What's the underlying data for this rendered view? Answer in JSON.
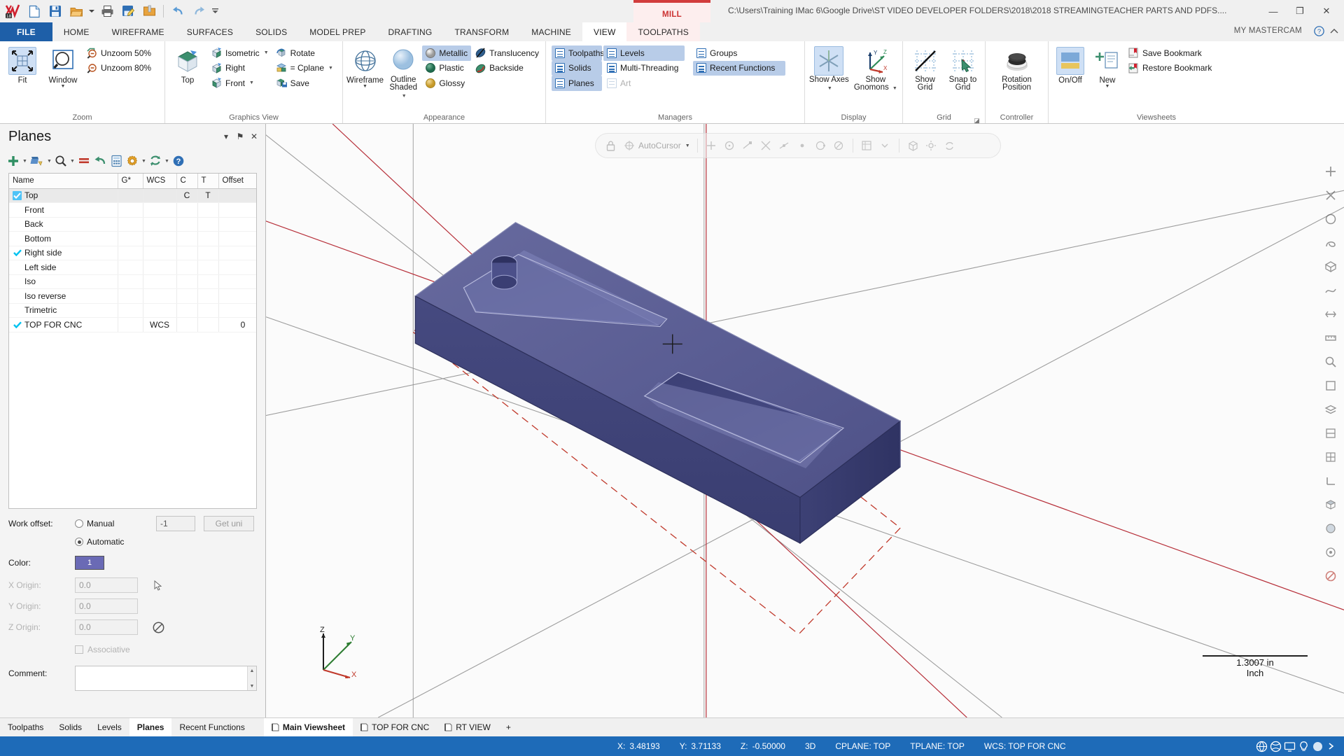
{
  "titlebar": {
    "quick_access": [
      {
        "name": "mastercam-logo",
        "label": "Mastercam 2018"
      },
      {
        "name": "new-icon",
        "label": "New"
      },
      {
        "name": "save-icon",
        "label": "Save"
      },
      {
        "name": "open-icon",
        "label": "Open"
      },
      {
        "name": "print-icon",
        "label": "Print"
      },
      {
        "name": "save-as-icon",
        "label": "Save As"
      },
      {
        "name": "zip2go-icon",
        "label": "Zip2Go"
      },
      {
        "name": "undo-icon",
        "label": "Undo"
      },
      {
        "name": "redo-icon",
        "label": "Redo"
      },
      {
        "name": "customize-qat-icon",
        "label": "Customize Quick Access Toolbar"
      }
    ],
    "machine_tag": "MILL",
    "document_path": "C:\\Users\\Training IMac 6\\Google Drive\\ST VIDEO DEVELOPER FOLDERS\\2018\\2018 STREAMINGTEACHER PARTS AND PDFS....",
    "window_buttons": {
      "minimize": "—",
      "restore": "❐",
      "close": "✕"
    }
  },
  "ribbon": {
    "tabs": [
      {
        "label": "FILE",
        "state": "file"
      },
      {
        "label": "HOME",
        "state": "normal"
      },
      {
        "label": "WIREFRAME",
        "state": "normal"
      },
      {
        "label": "SURFACES",
        "state": "normal"
      },
      {
        "label": "SOLIDS",
        "state": "normal"
      },
      {
        "label": "MODEL PREP",
        "state": "normal"
      },
      {
        "label": "DRAFTING",
        "state": "normal"
      },
      {
        "label": "TRANSFORM",
        "state": "normal"
      },
      {
        "label": "MACHINE",
        "state": "normal"
      },
      {
        "label": "VIEW",
        "state": "active"
      },
      {
        "label": "TOOLPATHS",
        "state": "toolpaths"
      }
    ],
    "brand_label": "MY MASTERCAM",
    "help_icons": [
      {
        "name": "help-icon",
        "label": "?"
      },
      {
        "name": "collapse-ribbon-icon",
        "label": "˄"
      }
    ],
    "groups": [
      {
        "name": "zoom",
        "title": "Zoom",
        "big_buttons": [
          {
            "name": "fit-button",
            "label": "Fit",
            "selected": true
          },
          {
            "name": "window-zoom-button",
            "label": "Window",
            "has_caret": true
          }
        ],
        "small_buttons": [
          {
            "name": "unzoom-50-button",
            "label": "Unzoom 50%"
          },
          {
            "name": "unzoom-80-button",
            "label": "Unzoom 80%"
          }
        ]
      },
      {
        "name": "graphics-view",
        "title": "Graphics View",
        "big_buttons": [
          {
            "name": "top-view-button",
            "label": "Top"
          }
        ],
        "small_buttons": [
          {
            "name": "isometric-view-button",
            "label": "Isometric",
            "has_caret": true
          },
          {
            "name": "right-view-button",
            "label": "Right"
          },
          {
            "name": "front-view-button",
            "label": "Front",
            "has_caret": true
          },
          {
            "name": "rotate-button",
            "label": "Rotate"
          },
          {
            "name": "equal-cplane-button",
            "label": "= Cplane",
            "has_caret": true
          },
          {
            "name": "save-view-button",
            "label": "Save"
          }
        ]
      },
      {
        "name": "appearance",
        "title": "Appearance",
        "big_buttons": [
          {
            "name": "wireframe-button",
            "label": "Wireframe",
            "has_caret": true
          },
          {
            "name": "outline-shaded-button",
            "label": "Outline Shaded",
            "has_caret": true
          }
        ],
        "small_buttons": [
          {
            "name": "metallic-button",
            "label": "Metallic",
            "highlighted": true
          },
          {
            "name": "plastic-button",
            "label": "Plastic"
          },
          {
            "name": "glossy-button",
            "label": "Glossy"
          },
          {
            "name": "translucency-button",
            "label": "Translucency"
          },
          {
            "name": "backside-button",
            "label": "Backside"
          }
        ]
      },
      {
        "name": "managers",
        "title": "Managers",
        "small_buttons": [
          {
            "name": "toolpaths-manager-button",
            "label": "Toolpaths",
            "highlighted": true
          },
          {
            "name": "solids-manager-button",
            "label": "Solids",
            "highlighted": true
          },
          {
            "name": "planes-manager-button",
            "label": "Planes",
            "highlighted": true
          },
          {
            "name": "levels-manager-button",
            "label": "Levels",
            "highlighted": true
          },
          {
            "name": "multi-threading-manager-button",
            "label": "Multi-Threading"
          },
          {
            "name": "art-manager-button",
            "label": "Art",
            "disabled": true
          },
          {
            "name": "groups-manager-button",
            "label": "Groups"
          },
          {
            "name": "recent-functions-button",
            "label": "Recent Functions",
            "highlighted": true
          }
        ]
      },
      {
        "name": "display",
        "title": "Display",
        "big_buttons": [
          {
            "name": "show-axes-button",
            "label": "Show Axes",
            "has_caret": true,
            "selected": true
          },
          {
            "name": "show-gnomons-button",
            "label": "Show Gnomons",
            "has_caret": true
          }
        ]
      },
      {
        "name": "grid",
        "title": "Grid",
        "big_buttons": [
          {
            "name": "show-grid-button",
            "label": "Show Grid"
          },
          {
            "name": "snap-to-grid-button",
            "label": "Snap to Grid"
          }
        ]
      },
      {
        "name": "controller",
        "title": "Controller",
        "big_buttons": [
          {
            "name": "rotation-position-button",
            "label": "Rotation Position"
          }
        ]
      },
      {
        "name": "viewsheets",
        "title": "Viewsheets",
        "big_buttons": [
          {
            "name": "viewsheets-onoff-button",
            "label": "On/Off",
            "selected": true
          },
          {
            "name": "new-viewsheet-button",
            "label": "New",
            "has_caret": true
          }
        ],
        "small_buttons": [
          {
            "name": "save-bookmark-button",
            "label": "Save Bookmark"
          },
          {
            "name": "restore-bookmark-button",
            "label": "Restore Bookmark"
          }
        ]
      }
    ]
  },
  "planes_panel": {
    "title": "Planes",
    "header_buttons": [
      {
        "name": "panel-dropdown-icon",
        "label": "▾"
      },
      {
        "name": "panel-pin-icon",
        "label": "⚑"
      },
      {
        "name": "panel-close-icon",
        "label": "✕"
      }
    ],
    "toolbar": [
      {
        "name": "create-new-plane-button",
        "label": "Create new plane",
        "caret": true
      },
      {
        "name": "select-plane-button",
        "label": "Select plane",
        "caret": true
      },
      {
        "name": "find-plane-button",
        "label": "Find plane",
        "caret": true
      },
      {
        "name": "delete-plane-button",
        "label": "Delete plane"
      },
      {
        "name": "undo-plane-button",
        "label": "Undo"
      },
      {
        "name": "plane-list-button",
        "label": "Plane list"
      },
      {
        "name": "plane-settings-button",
        "label": "Settings",
        "caret": true
      },
      {
        "name": "refresh-planes-button",
        "label": "Refresh",
        "caret": true
      },
      {
        "name": "plane-help-button",
        "label": "Help"
      }
    ],
    "table": {
      "columns": [
        "Name",
        "G*",
        "WCS",
        "C",
        "T",
        "Offset"
      ],
      "rows": [
        {
          "name": "Top",
          "check": "box",
          "g": "",
          "wcs": "",
          "c": "C",
          "t": "T",
          "offset": "",
          "selected": true
        },
        {
          "name": "Front",
          "check": "none",
          "g": "",
          "wcs": "",
          "c": "",
          "t": "",
          "offset": ""
        },
        {
          "name": "Back",
          "check": "none",
          "g": "",
          "wcs": "",
          "c": "",
          "t": "",
          "offset": ""
        },
        {
          "name": "Bottom",
          "check": "none",
          "g": "",
          "wcs": "",
          "c": "",
          "t": "",
          "offset": ""
        },
        {
          "name": "Right side",
          "check": "tick",
          "g": "",
          "wcs": "",
          "c": "",
          "t": "",
          "offset": ""
        },
        {
          "name": "Left side",
          "check": "none",
          "g": "",
          "wcs": "",
          "c": "",
          "t": "",
          "offset": ""
        },
        {
          "name": "Iso",
          "check": "none",
          "g": "",
          "wcs": "",
          "c": "",
          "t": "",
          "offset": ""
        },
        {
          "name": "Iso reverse",
          "check": "none",
          "g": "",
          "wcs": "",
          "c": "",
          "t": "",
          "offset": ""
        },
        {
          "name": "Trimetric",
          "check": "none",
          "g": "",
          "wcs": "",
          "c": "",
          "t": "",
          "offset": ""
        },
        {
          "name": "TOP FOR CNC",
          "check": "tick",
          "g": "",
          "wcs": "WCS",
          "c": "",
          "t": "",
          "offset": "0"
        }
      ]
    },
    "form": {
      "work_offset_label": "Work offset:",
      "manual_label": "Manual",
      "automatic_label": "Automatic",
      "work_offset_mode": "Automatic",
      "work_offset_value": "-1",
      "get_unique_label": "Get uni",
      "color_label": "Color:",
      "color_value": "1",
      "color_hex": "#6a6ab5",
      "x_origin_label": "X Origin:",
      "x_origin_value": "0.0",
      "y_origin_label": "Y Origin:",
      "y_origin_value": "0.0",
      "z_origin_label": "Z Origin:",
      "z_origin_value": "0.0",
      "associative_label": "Associative",
      "comment_label": "Comment:",
      "comment_value": ""
    }
  },
  "viewport": {
    "autocursor": {
      "label": "AutoCursor",
      "icons": [
        "autocursor-origin-icon",
        "autocursor-arc-center-icon",
        "autocursor-endpoint-icon",
        "autocursor-intersection-icon",
        "autocursor-midpoint-icon",
        "autocursor-point-icon",
        "autocursor-quadrant-icon",
        "autocursor-nearest-icon",
        "autocursor-relative-icon",
        "autocursor-tangent-icon",
        "autocursor-perpendicular-icon",
        "autocursor-solid-icon",
        "autocursor-settings-icon",
        "autocursor-refresh-icon"
      ]
    },
    "scale": {
      "value": "1.3007 in",
      "unit": "Inch"
    },
    "gnomon": {
      "x": "X",
      "y": "Y",
      "z": "Z"
    },
    "right_toolbar": [
      "fit-icon",
      "dynamic-rotate-icon",
      "circle-icon",
      "spiral-icon",
      "mesh-icon",
      "surface-icon",
      "flip-icon",
      "ruler-icon",
      "analyze-icon",
      "box-icon",
      "layers-icon",
      "section-icon",
      "grid-icon",
      "axis-icon",
      "solid-icon",
      "shade-icon",
      "target-icon",
      "no-entry-icon"
    ]
  },
  "bottom_tabs": {
    "manager_tabs": [
      {
        "label": "Toolpaths",
        "active": false
      },
      {
        "label": "Solids",
        "active": false
      },
      {
        "label": "Levels",
        "active": false
      },
      {
        "label": "Planes",
        "active": true
      },
      {
        "label": "Recent Functions",
        "active": false
      }
    ],
    "viewsheet_tabs": [
      {
        "label": "Main Viewsheet",
        "active": true
      },
      {
        "label": "TOP FOR CNC",
        "active": false
      },
      {
        "label": "RT VIEW",
        "active": false
      }
    ],
    "add_viewsheet_label": "+"
  },
  "statusbar": {
    "x_label": "X:",
    "x_value": "3.48193",
    "y_label": "Y:",
    "y_value": "3.71133",
    "z_label": "Z:",
    "z_value": "-0.50000",
    "mode": "3D",
    "cplane": "CPLANE: TOP",
    "tplane": "TPLANE: TOP",
    "wcs": "WCS: TOP FOR CNC",
    "icons": [
      "globe-icon",
      "globe2-icon",
      "monitor-icon",
      "lightbulb-icon",
      "sphere-icon",
      "chevron-icon"
    ]
  }
}
